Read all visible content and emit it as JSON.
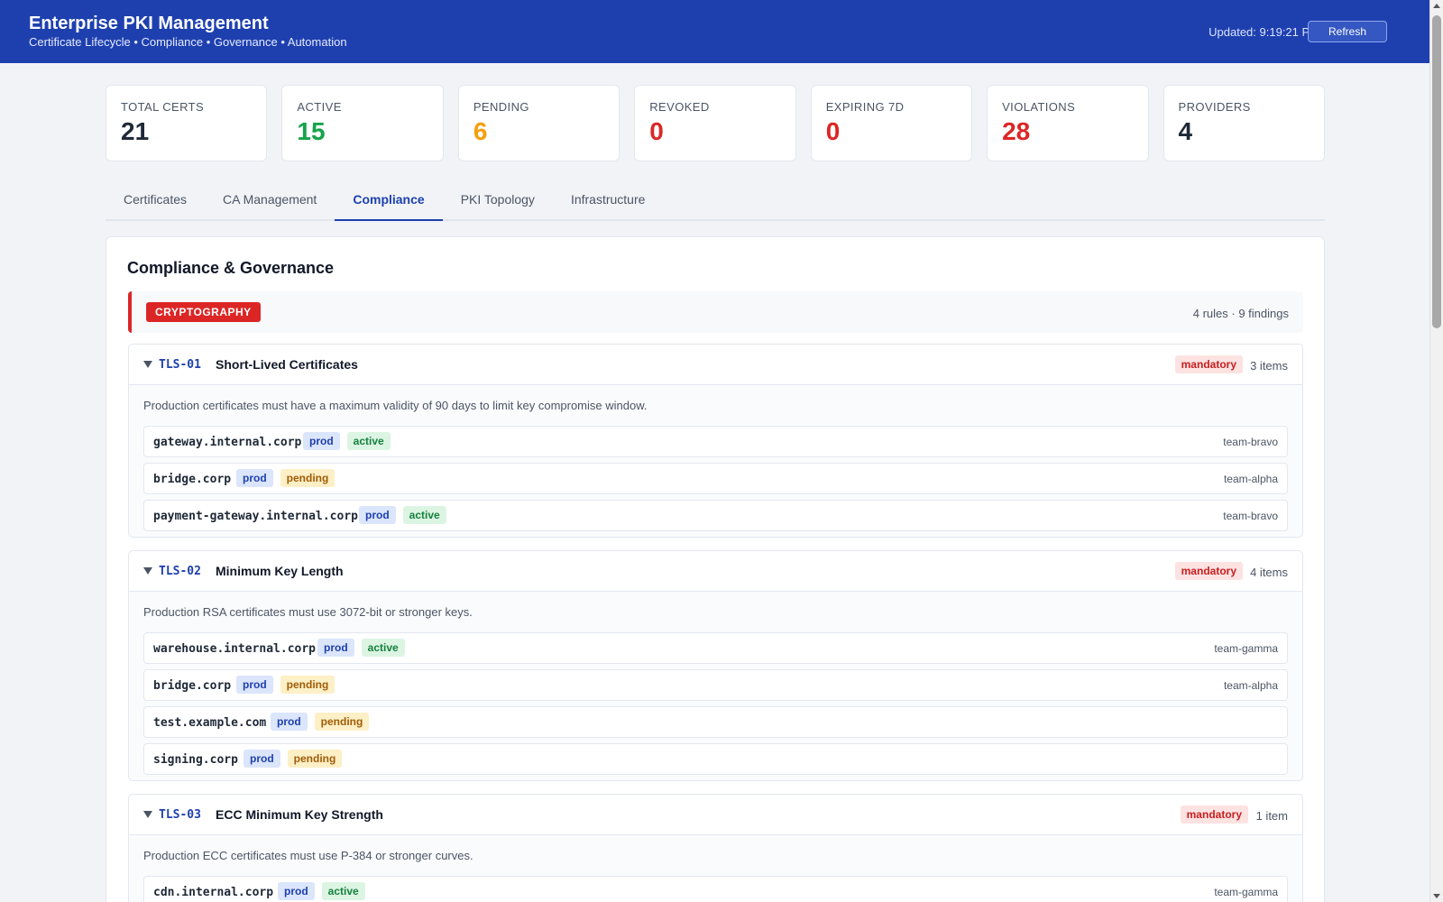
{
  "header": {
    "title": "Enterprise PKI Management",
    "subtitle": "Certificate Lifecycle • Compliance • Governance • Automation",
    "updated": "Updated: 9:19:21 PM",
    "refresh_label": "Refresh"
  },
  "stats": [
    {
      "label": "TOTAL CERTS",
      "value": "21",
      "color": "#1f2937"
    },
    {
      "label": "ACTIVE",
      "value": "15",
      "color": "#16a34a"
    },
    {
      "label": "PENDING",
      "value": "6",
      "color": "#f59e0b"
    },
    {
      "label": "REVOKED",
      "value": "0",
      "color": "#dc2626"
    },
    {
      "label": "EXPIRING 7D",
      "value": "0",
      "color": "#dc2626"
    },
    {
      "label": "VIOLATIONS",
      "value": "28",
      "color": "#dc2626"
    },
    {
      "label": "PROVIDERS",
      "value": "4",
      "color": "#1f2937"
    }
  ],
  "tabs": [
    "Certificates",
    "CA Management",
    "Compliance",
    "PKI Topology",
    "Infrastructure"
  ],
  "active_tab": "Compliance",
  "panel": {
    "title": "Compliance & Governance",
    "category": {
      "name": "CRYPTOGRAPHY",
      "meta": "4 rules · 9 findings",
      "color": "#dc2626"
    },
    "rules": [
      {
        "id": "TLS-01",
        "name": "Short-Lived Certificates",
        "severity": "mandatory",
        "count": "3 items",
        "description": "Production certificates must have a maximum validity of 90 days to limit key compromise window.",
        "items": [
          {
            "host": "gateway.internal.corp",
            "env": "prod",
            "status": "active",
            "team": "team-bravo"
          },
          {
            "host": "bridge.corp",
            "env": "prod",
            "status": "pending",
            "team": "team-alpha"
          },
          {
            "host": "payment-gateway.internal.corp",
            "env": "prod",
            "status": "active",
            "team": "team-bravo"
          }
        ]
      },
      {
        "id": "TLS-02",
        "name": "Minimum Key Length",
        "severity": "mandatory",
        "count": "4 items",
        "description": "Production RSA certificates must use 3072-bit or stronger keys.",
        "items": [
          {
            "host": "warehouse.internal.corp",
            "env": "prod",
            "status": "active",
            "team": "team-gamma"
          },
          {
            "host": "bridge.corp",
            "env": "prod",
            "status": "pending",
            "team": "team-alpha"
          },
          {
            "host": "test.example.com",
            "env": "prod",
            "status": "pending",
            "team": ""
          },
          {
            "host": "signing.corp",
            "env": "prod",
            "status": "pending",
            "team": ""
          }
        ]
      },
      {
        "id": "TLS-03",
        "name": "ECC Minimum Key Strength",
        "severity": "mandatory",
        "count": "1 item",
        "description": "Production ECC certificates must use P-384 or stronger curves.",
        "items": [
          {
            "host": "cdn.internal.corp",
            "env": "prod",
            "status": "active",
            "team": "team-gamma"
          }
        ]
      }
    ]
  }
}
